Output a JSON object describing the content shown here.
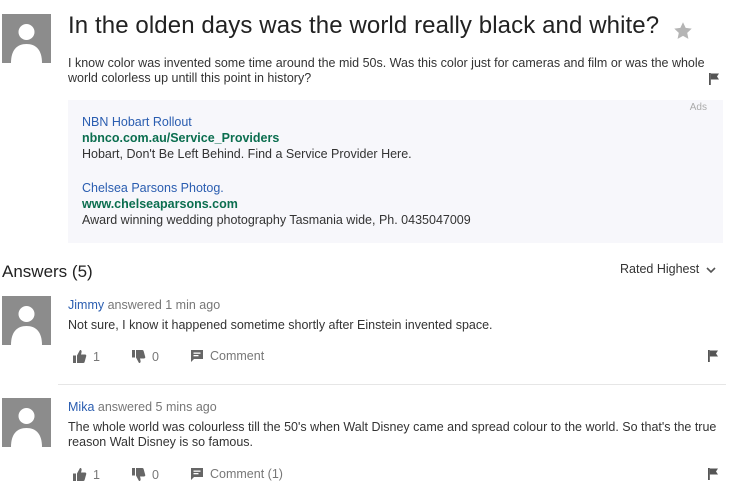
{
  "question": {
    "title": "In the olden days was the world really black and white?",
    "body": "I know color was invented some time around the mid 50s. Was this color just for cameras and film or was the whole world colorless up untill this point in history?"
  },
  "ads": {
    "label": "Ads",
    "items": [
      {
        "title": "NBN Hobart Rollout",
        "url": "nbnco.com.au/Service_Providers",
        "description": "Hobart, Don't Be Left Behind. Find a Service Provider Here."
      },
      {
        "title": "Chelsea Parsons Photog.",
        "url": "www.chelseaparsons.com",
        "description": "Award winning wedding photography Tasmania wide, Ph. 0435047009"
      }
    ]
  },
  "answers": {
    "heading": "Answers (5)",
    "sort_label": "Rated Highest",
    "items": [
      {
        "author": "Jimmy",
        "meta": " answered 1 min ago",
        "text": "Not sure, I know it happened sometime shortly after Einstein invented space.",
        "thumbs_up": "1",
        "thumbs_down": "0",
        "comment_label": "Comment"
      },
      {
        "author": "Mika",
        "meta": " answered 5 mins ago",
        "text": "The whole world was colourless till the 50's when Walt Disney came and spread colour to the world. So that's the true reason Walt Disney is so famous.",
        "thumbs_up": "1",
        "thumbs_down": "0",
        "comment_label": "Comment (1)"
      }
    ]
  },
  "colors": {
    "link": "#2a5db0",
    "ad_url": "#0b6e4f",
    "avatar": "#8c8c8c",
    "ads_background": "#f7f7fb"
  },
  "icons": [
    "avatar-icon",
    "star-icon",
    "flag-icon",
    "thumbs-up-icon",
    "thumbs-down-icon",
    "comment-icon",
    "chevron-down-icon"
  ]
}
